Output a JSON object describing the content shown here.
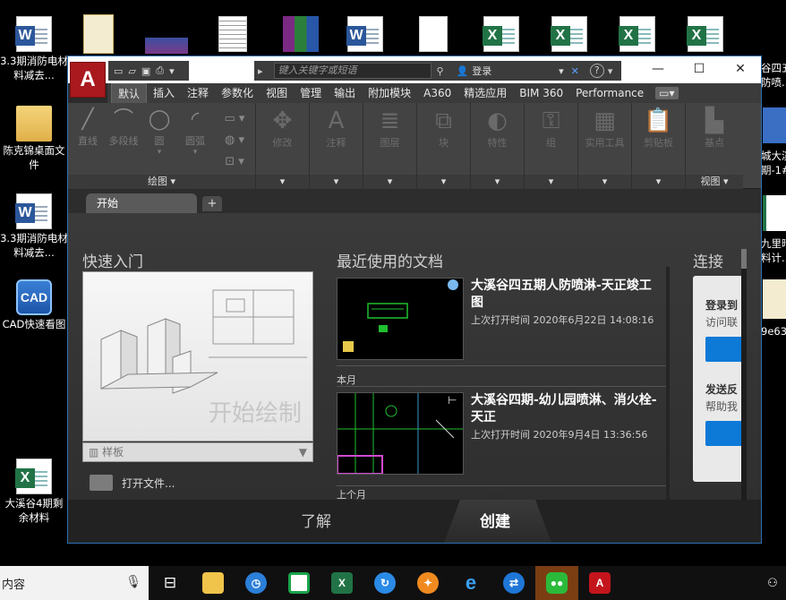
{
  "desktop": {
    "left_icons": [
      {
        "label": "3.3期消防电材料减去...",
        "kind": "word"
      },
      {
        "label": "陈克锦桌面文件",
        "kind": "folder"
      },
      {
        "label": "3.3期消防电材料减去...",
        "kind": "word"
      },
      {
        "label": "CAD快速看图",
        "kind": "cad"
      },
      {
        "label": "大溪谷4期剩余材料",
        "kind": "excel"
      }
    ],
    "right_fragments": [
      "谷四五",
      "防喷...",
      "城大溪",
      "期-1#",
      "九里晴",
      "料计...",
      "9e636"
    ],
    "cad_icon_text": "CAD"
  },
  "taskbar": {
    "search_text": "内容",
    "icons": [
      "mic-icon",
      "task-view-icon",
      "file-explorer-icon",
      "clock-app-icon",
      "cad-viewer-icon",
      "excel-icon",
      "arrow-app-icon",
      "orange-app-icon",
      "ie-icon",
      "teamviewer-icon",
      "wechat-icon",
      "autocad-icon"
    ]
  },
  "autocad": {
    "logo": "A",
    "search_placeholder": "键入关键字或短语",
    "login_label": "登录",
    "help_label": "?",
    "ribbon_tabs": [
      "默认",
      "插入",
      "注释",
      "参数化",
      "视图",
      "管理",
      "输出",
      "附加模块",
      "A360",
      "精选应用",
      "BIM 360",
      "Performance"
    ],
    "active_tab": "默认",
    "draw_tools": [
      "直线",
      "多段线",
      "圆",
      "圆弧"
    ],
    "draw_panel_title": "绘图 ▾",
    "panels": [
      "修改",
      "注释",
      "图层",
      "块",
      "特性",
      "组",
      "实用工具",
      "剪贴板",
      "基点"
    ],
    "view_panel_title": "视图 ▾",
    "doc_tab": "开始",
    "start_page": {
      "quick_start_title": "快速入门",
      "start_draw": "开始绘制",
      "template_label": "样板",
      "open_file": "打开文件...",
      "recent_title": "最近使用的文档",
      "connect_title": "连接",
      "recent": [
        {
          "title": "大溪谷四五期人防喷淋-天正竣工图",
          "time": "上次打开时间 2020年6月22日 14:08:16"
        },
        {
          "title": "大溪谷四期-幼儿园喷淋、消火栓-天正",
          "time": "上次打开时间 2020年9月4日 13:36:56"
        }
      ],
      "group_this_month": "本月",
      "group_last_month": "上个月",
      "connect_login": "登录到",
      "connect_login_sub": "访问联",
      "connect_feedback": "发送反",
      "connect_feedback_sub": "帮助我"
    },
    "bottom": {
      "learn": "了解",
      "create": "创建"
    }
  }
}
